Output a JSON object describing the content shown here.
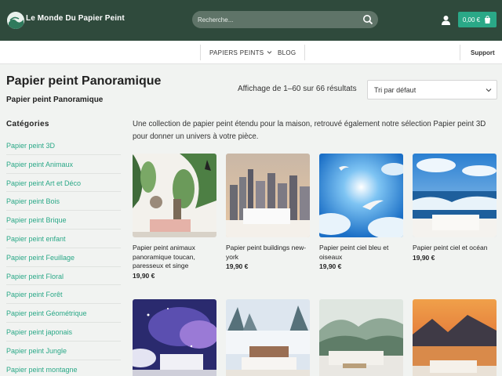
{
  "header": {
    "brand": "Le Monde Du Papier Peint",
    "search_placeholder": "Recherche...",
    "cart": "0,00 €"
  },
  "nav": {
    "papiers": "PAPIERS PEINTS",
    "blog": "BLOG",
    "support": "Support"
  },
  "page": {
    "title": "Papier peint Panoramique",
    "breadcrumb": "Papier peint Panoramique",
    "results": "Affichage de 1–60 sur 66 résultats",
    "sort": "Tri par défaut",
    "intro": "Une collection de papier peint étendu pour la maison, retrouvé également notre sélection Papier peint 3D pour donner un univers à votre pièce."
  },
  "sidebar": {
    "title": "Catégories",
    "items": [
      "Papier peint 3D",
      "Papier peint Animaux",
      "Papier peint Art et Déco",
      "Papier peint Bois",
      "Papier peint Brique",
      "Papier peint enfant",
      "Papier peint Feuillage",
      "Papier peint Floral",
      "Papier peint Forêt",
      "Papier peint Géométrique",
      "Papier peint japonais",
      "Papier peint Jungle",
      "Papier peint montagne"
    ]
  },
  "products": [
    {
      "name": "Papier peint animaux panoramique toucan, paresseux et singe",
      "price": "19,90 €"
    },
    {
      "name": "Papier peint buildings new-york",
      "price": "19,90 €"
    },
    {
      "name": "Papier peint ciel bleu et oiseaux",
      "price": "19,90 €"
    },
    {
      "name": "Papier peint ciel et océan",
      "price": "19,90 €"
    },
    {
      "name": "",
      "price": ""
    },
    {
      "name": "",
      "price": ""
    },
    {
      "name": "",
      "price": ""
    },
    {
      "name": "",
      "price": ""
    }
  ],
  "colors": {
    "header_bg": "#2f4a3c",
    "accent": "#2aa887",
    "search_bg": "#5f7468"
  },
  "icons": [
    "search-icon",
    "user-icon",
    "cart-icon",
    "chevron-down-icon",
    "logo-icon"
  ]
}
